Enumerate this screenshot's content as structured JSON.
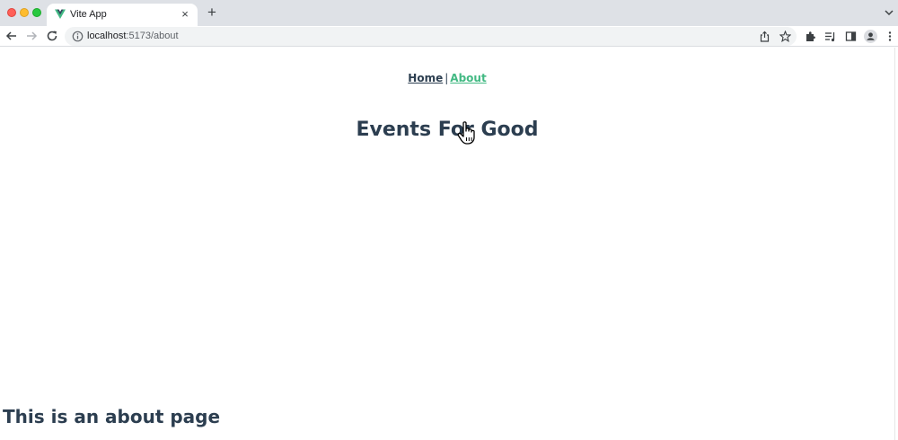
{
  "browser": {
    "tab_title": "Vite App",
    "tab_close_glyph": "×",
    "new_tab_glyph": "+",
    "url_host": "localhost",
    "url_rest": ":5173/about",
    "icons": {
      "back": "back-arrow-icon",
      "forward": "forward-arrow-icon",
      "reload": "reload-icon",
      "info": "info-icon",
      "share": "share-icon",
      "bookmark": "star-icon",
      "extensions": "puzzle-icon",
      "reading_list": "reading-list-icon",
      "side_panel": "side-panel-icon",
      "profile": "profile-icon",
      "menu": "kebab-menu-icon"
    }
  },
  "page": {
    "nav": {
      "home_label": "Home",
      "separator": "|",
      "about_label": "About"
    },
    "site_title": "Events For Good",
    "about_heading": "This is an about page"
  },
  "colors": {
    "text": "#2c3e50",
    "active_link": "#42b983",
    "vue_green": "#41b883",
    "vue_dark": "#34495e"
  }
}
